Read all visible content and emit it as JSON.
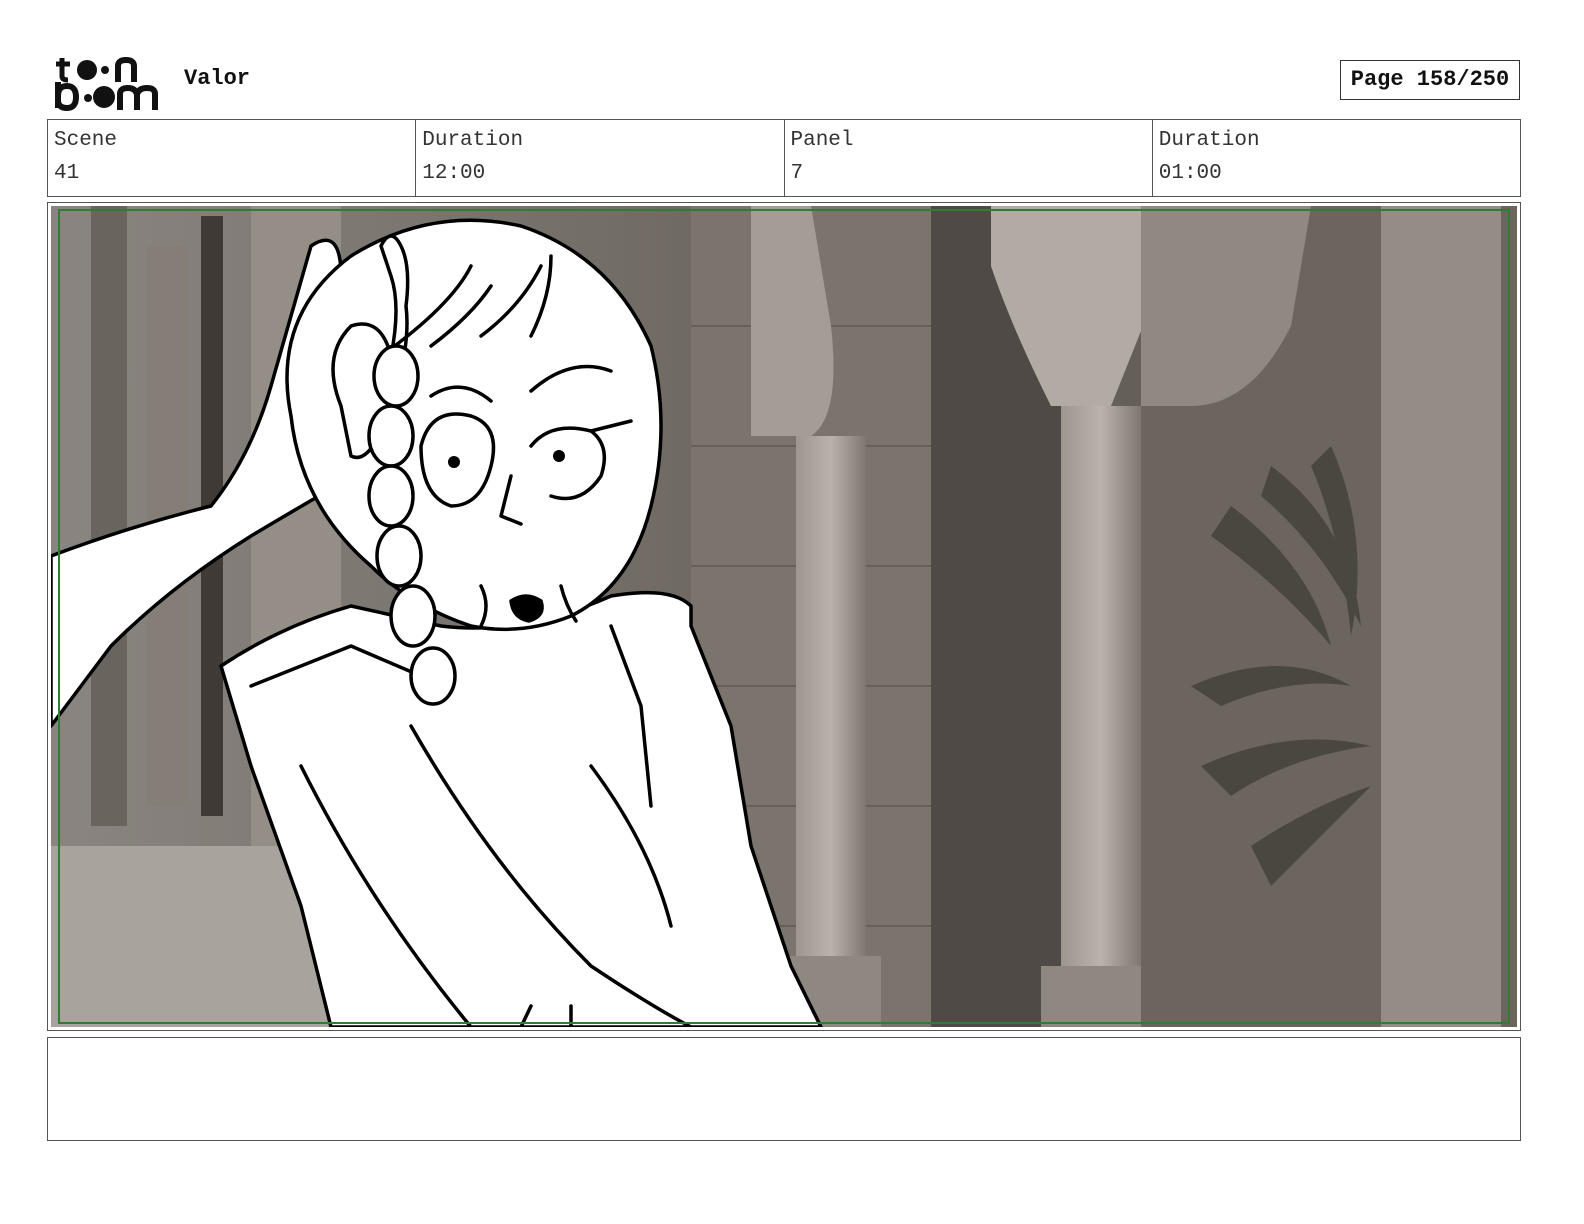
{
  "header": {
    "logo_icon": "toon-boom-logo",
    "project_title": "Valor",
    "page_label": "Page 158/250"
  },
  "info": {
    "scene_label": "Scene",
    "scene_value": "41",
    "scene_duration_label": "Duration",
    "scene_duration_value": "12:00",
    "panel_label": "Panel",
    "panel_value": "7",
    "panel_duration_label": "Duration",
    "panel_duration_value": "01:00"
  },
  "panel": {
    "image_icon": "storyboard-sketch-girl-braid-colonnade",
    "frame_color": "#2e7d32"
  },
  "notes": {
    "text": ""
  }
}
